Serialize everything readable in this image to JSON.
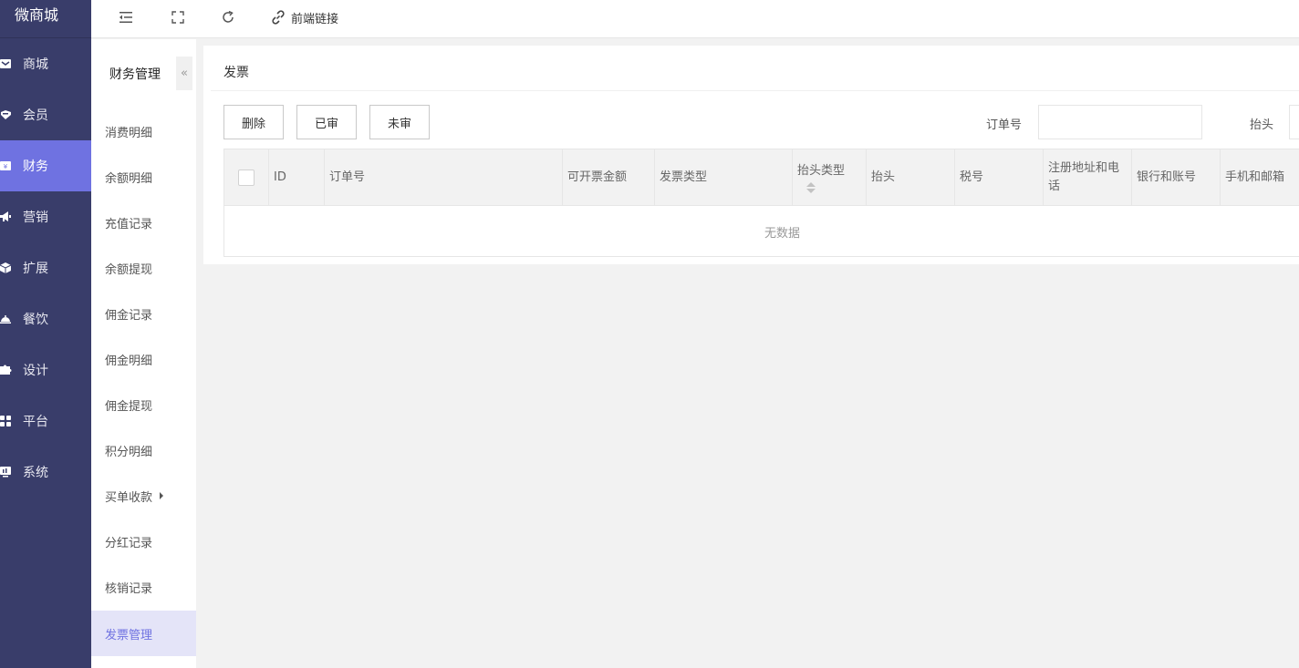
{
  "app": {
    "title": "微商城"
  },
  "sidebar": {
    "items": [
      {
        "label": "商城",
        "icon": "store-icon",
        "active": false
      },
      {
        "label": "会员",
        "icon": "member-icon",
        "active": false
      },
      {
        "label": "财务",
        "icon": "finance-icon",
        "active": true
      },
      {
        "label": "营销",
        "icon": "megaphone-icon",
        "active": false
      },
      {
        "label": "扩展",
        "icon": "cube-icon",
        "active": false
      },
      {
        "label": "餐饮",
        "icon": "dining-icon",
        "active": false
      },
      {
        "label": "设计",
        "icon": "puzzle-icon",
        "active": false
      },
      {
        "label": "平台",
        "icon": "grid-icon",
        "active": false
      },
      {
        "label": "系统",
        "icon": "monitor-icon",
        "active": false
      }
    ]
  },
  "topbar": {
    "link_label": "前端链接",
    "icons": [
      "menu-fold-icon",
      "fullscreen-icon",
      "refresh-icon",
      "link-icon"
    ]
  },
  "submenu": {
    "title": "财务管理",
    "collapse_glyph": "«",
    "items": [
      {
        "label": "消费明细"
      },
      {
        "label": "余额明细"
      },
      {
        "label": "充值记录"
      },
      {
        "label": "余额提现"
      },
      {
        "label": "佣金记录"
      },
      {
        "label": "佣金明细"
      },
      {
        "label": "佣金提现"
      },
      {
        "label": "积分明细"
      },
      {
        "label": "买单收款",
        "has_children": true
      },
      {
        "label": "分红记录"
      },
      {
        "label": "核销记录"
      },
      {
        "label": "发票管理",
        "active": true
      }
    ]
  },
  "main": {
    "card_title": "发票",
    "buttons": {
      "delete": "删除",
      "approved": "已审",
      "unapproved": "未审"
    },
    "filters": {
      "order_no_label": "订单号",
      "order_no_value": "",
      "header_label": "抬头",
      "header_value": ""
    },
    "table": {
      "columns": [
        "ID",
        "订单号",
        "可开票金额",
        "发票类型",
        "抬头类型",
        "抬头",
        "税号",
        "注册地址和电话",
        "银行和账号",
        "手机和邮箱"
      ],
      "rows": [],
      "empty_text": "无数据"
    }
  },
  "colors": {
    "sidebar_bg": "#393D6A",
    "accent": "#6F72E1",
    "submenu_active_bg": "#E4E4F8"
  }
}
